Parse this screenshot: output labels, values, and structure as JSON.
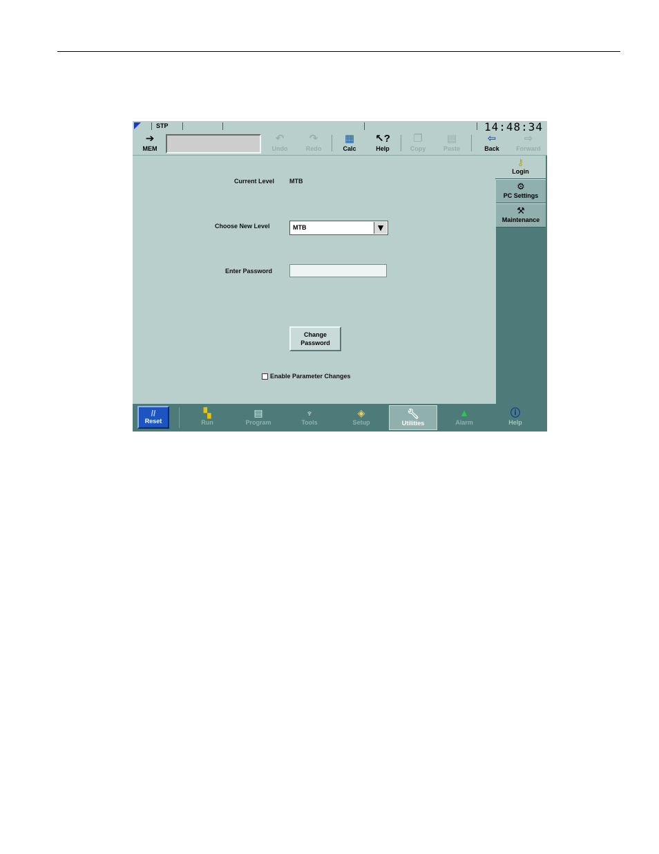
{
  "status": {
    "mode": "STP",
    "clock": "14:48:34"
  },
  "toolbar": {
    "mem": "MEM",
    "undo": "Undo",
    "redo": "Redo",
    "calc": "Calc",
    "help": "Help",
    "copy": "Copy",
    "paste": "Paste",
    "back": "Back",
    "forward": "Forward"
  },
  "form": {
    "current_level_label": "Current Level",
    "current_level_value": "MTB",
    "choose_level_label": "Choose New Level",
    "choose_level_value": "MTB",
    "password_label": "Enter Password",
    "password_value": "",
    "change_password_line1": "Change",
    "change_password_line2": "Password",
    "enable_param_label": "Enable Parameter Changes"
  },
  "sidetabs": {
    "login": "Login",
    "pc_settings": "PC Settings",
    "maintenance": "Maintenance"
  },
  "nav": {
    "reset": "Reset",
    "run": "Run",
    "program": "Program",
    "tools": "Tools",
    "setup": "Setup",
    "utilities": "Utilities",
    "alarm": "Alarm",
    "help": "Help"
  },
  "colors": {
    "panel": "#b8cfcc",
    "frame": "#4d7b79",
    "reset": "#1c54c2"
  }
}
